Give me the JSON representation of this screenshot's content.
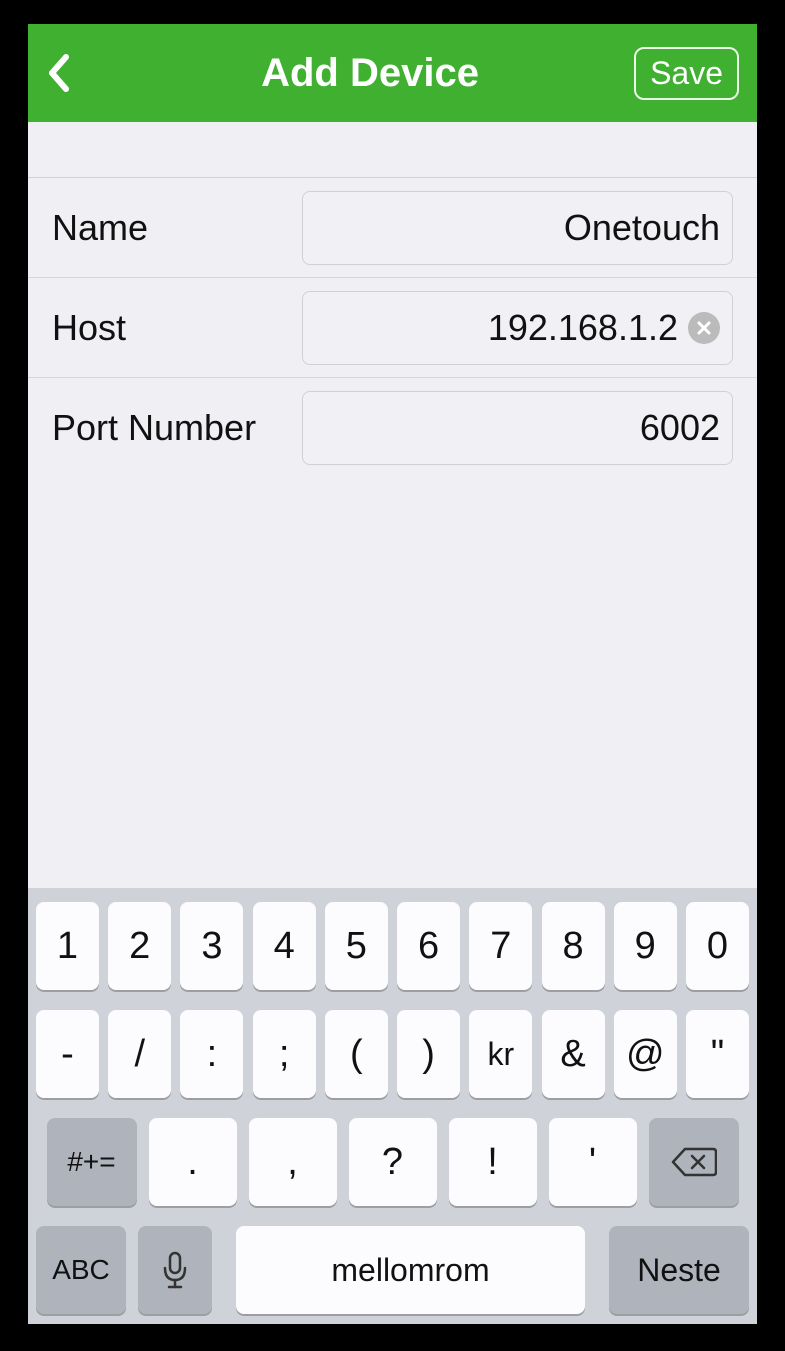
{
  "header": {
    "title": "Add Device",
    "save_label": "Save"
  },
  "form": {
    "name_label": "Name",
    "name_value": "Onetouch",
    "host_label": "Host",
    "host_value": "192.168.1.2",
    "port_label": "Port Number",
    "port_value": "6002"
  },
  "keyboard": {
    "row1": [
      "1",
      "2",
      "3",
      "4",
      "5",
      "6",
      "7",
      "8",
      "9",
      "0"
    ],
    "row2": [
      "-",
      "/",
      ":",
      ";",
      "(",
      ")",
      "kr",
      "&",
      "@",
      "\""
    ],
    "row3_sym": "#+=",
    "row3_punct": [
      ".",
      ",",
      "?",
      "!",
      "'"
    ],
    "row4_abc": "ABC",
    "row4_space": "mellomrom",
    "row4_next": "Neste"
  }
}
